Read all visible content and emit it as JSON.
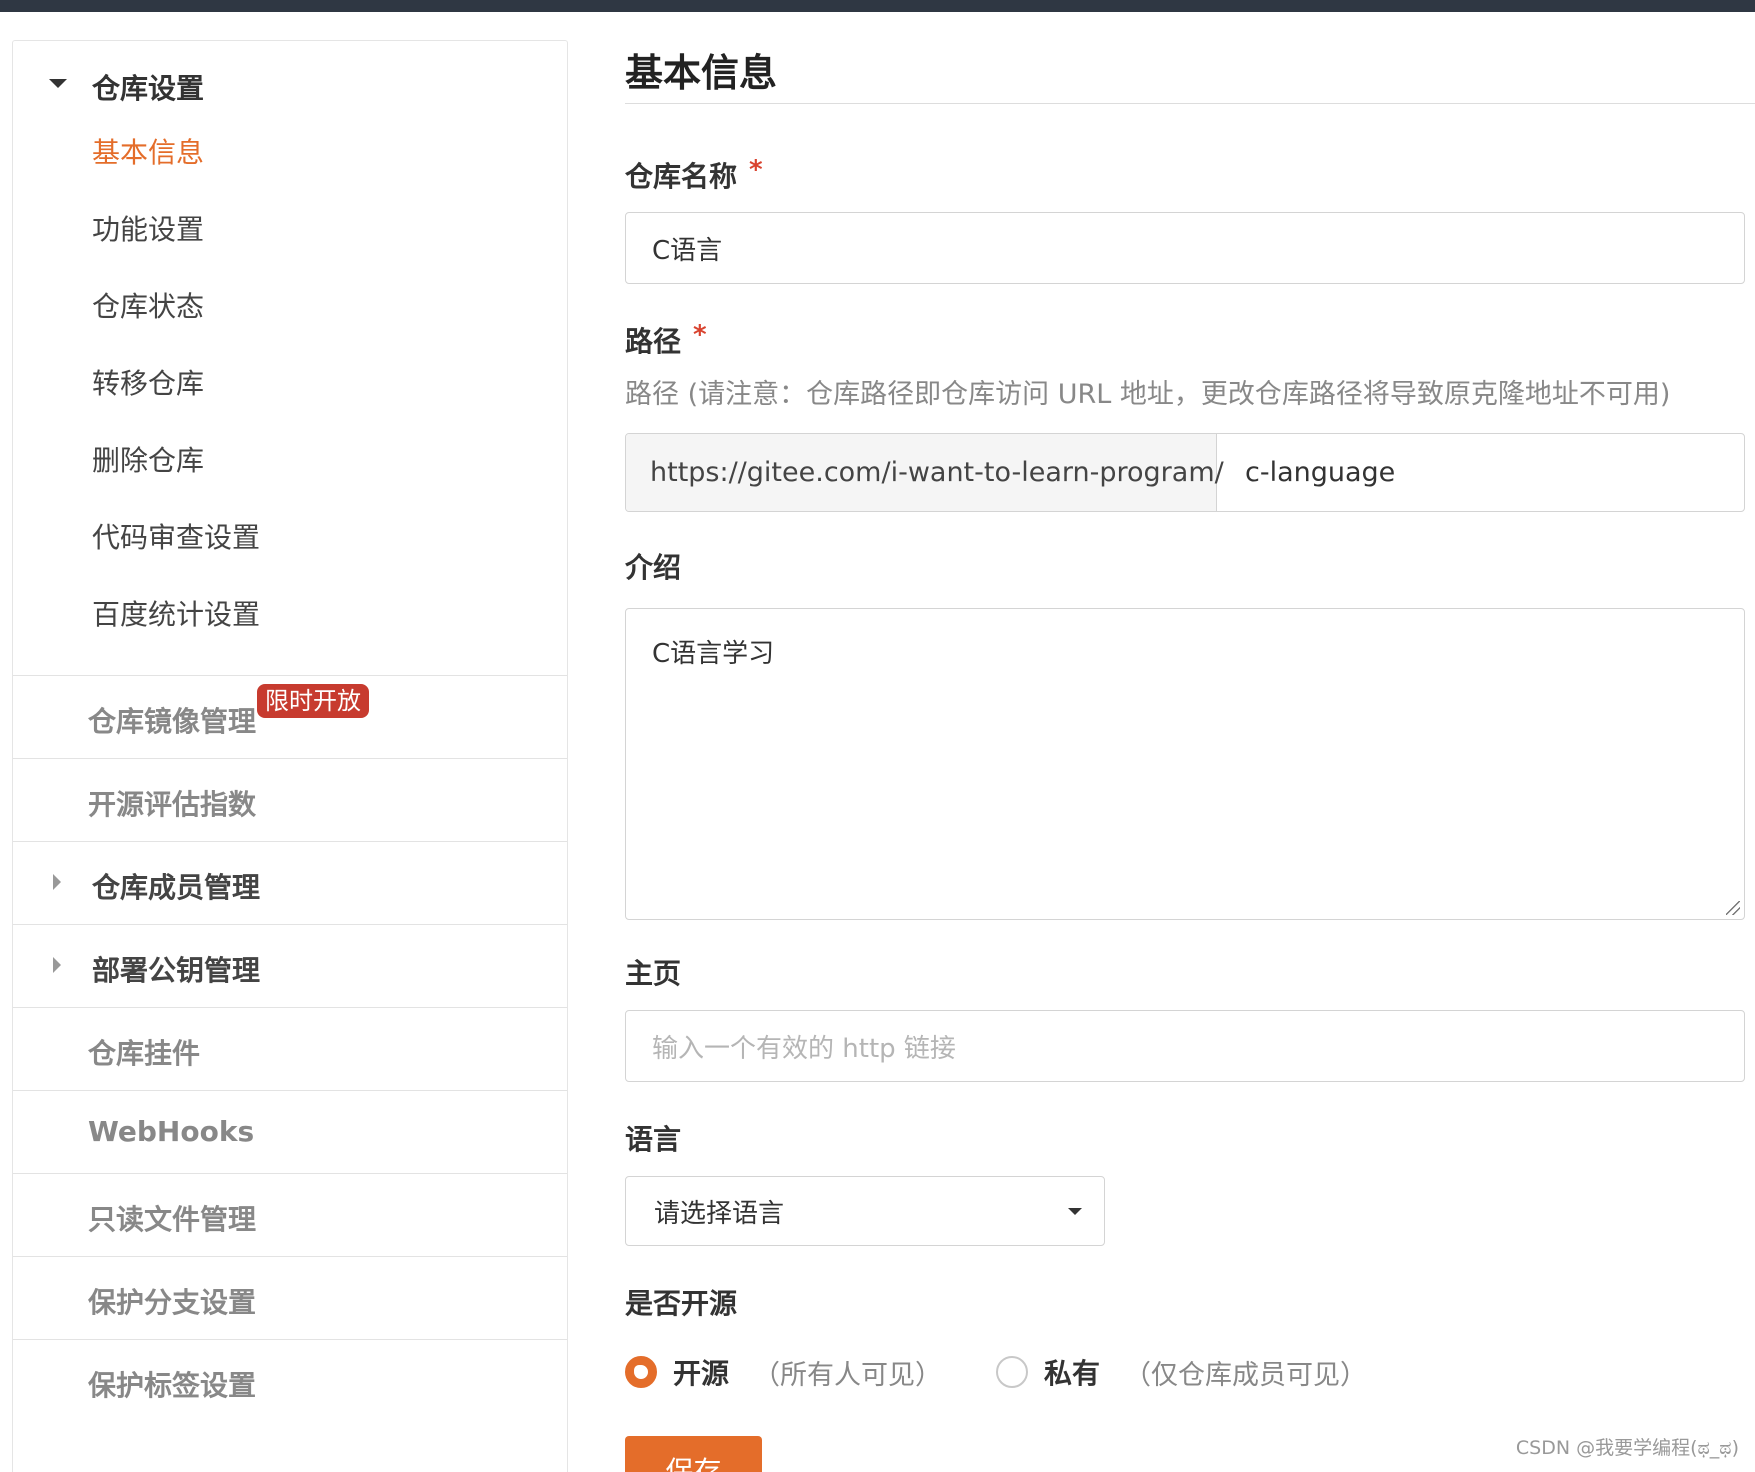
{
  "sidebar": {
    "group_title": "仓库设置",
    "sub_items": [
      "基本信息",
      "功能设置",
      "仓库状态",
      "转移仓库",
      "删除仓库",
      "代码审查设置",
      "百度统计设置"
    ],
    "sections": [
      {
        "label": "仓库镜像管理",
        "badge": "限时开放"
      },
      {
        "label": "开源评估指数"
      },
      {
        "label": "仓库成员管理"
      },
      {
        "label": "部署公钥管理"
      },
      {
        "label": "仓库挂件"
      },
      {
        "label": "WebHooks"
      },
      {
        "label": "只读文件管理"
      },
      {
        "label": "保护分支设置"
      },
      {
        "label": "保护标签设置"
      }
    ]
  },
  "main": {
    "title": "基本信息",
    "name_field": {
      "label": "仓库名称",
      "required_mark": "*",
      "value": "C语言"
    },
    "path_field": {
      "label": "路径",
      "required_mark": "*",
      "hint": "路径 (请注意：仓库路径即仓库访问 URL 地址，更改仓库路径将导致原克隆地址不可用)",
      "prefix": "https://gitee.com/i-want-to-learn-program/",
      "value": "c-language"
    },
    "intro_field": {
      "label": "介绍",
      "value": "C语言学习"
    },
    "homepage_field": {
      "label": "主页",
      "placeholder": "输入一个有效的 http 链接"
    },
    "language_field": {
      "label": "语言",
      "selected": "请选择语言"
    },
    "open_source": {
      "label": "是否开源",
      "options": [
        {
          "label": "开源",
          "desc": "（所有人可见）",
          "checked": true
        },
        {
          "label": "私有",
          "desc": "（仅仓库成员可见）",
          "checked": false
        }
      ]
    },
    "save_label": "保存"
  },
  "watermark": "CSDN @我要学编程(ಥ_ಥ)",
  "colors": {
    "accent": "#e46d2a",
    "badge": "#c73b2f",
    "required": "#d9432f",
    "topbar": "#2f3743"
  }
}
